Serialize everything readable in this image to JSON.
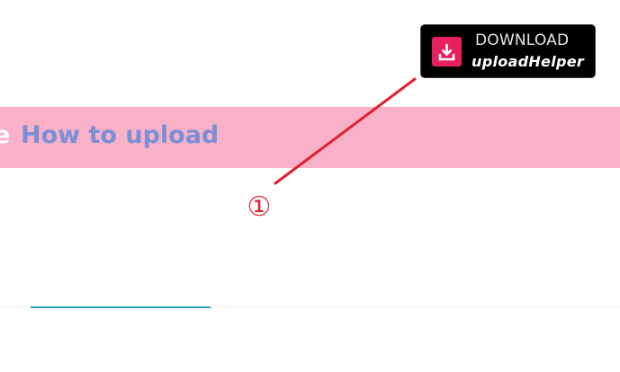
{
  "download_badge": {
    "line1": "DOWNLOAD",
    "line2": "uploadHelper",
    "icon": "download-tray-icon",
    "icon_color": "#e8205e",
    "background_color": "#000000"
  },
  "banner": {
    "partial_text": "e",
    "link_text": "How to upload",
    "background_color": "#f8b1c6",
    "link_color": "#7a8fd6"
  },
  "annotation": {
    "step_number": "①",
    "color": "#e02030"
  }
}
